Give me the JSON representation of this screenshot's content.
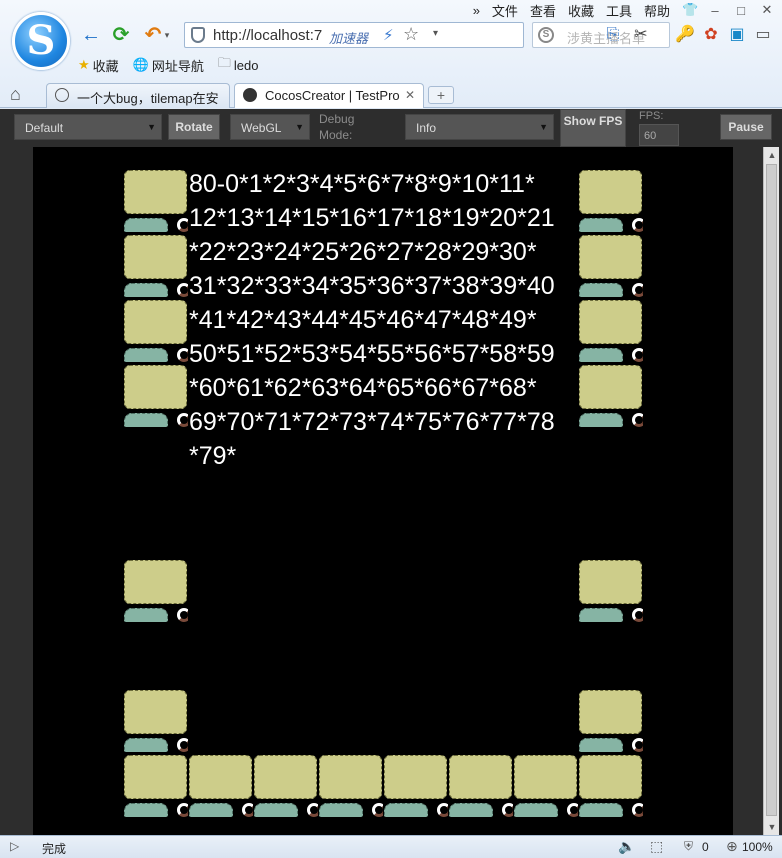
{
  "menubar": {
    "expand": "»",
    "items": [
      "文件",
      "查看",
      "收藏",
      "工具",
      "帮助"
    ],
    "skin": "👕",
    "minimize": "–",
    "maximize": "□",
    "close": "✕"
  },
  "browser": {
    "logo_letter": "S",
    "back": "←",
    "refresh": "⟳",
    "undo": "↶",
    "undo_dd": "▾",
    "url": "http://localhost:7",
    "accelerator": "加速器",
    "bolt": "⚡",
    "star": "☆",
    "url_dd": "▾",
    "search_icon": "S",
    "search_placeholder": "涉黄主播名单",
    "tools": [
      "⎘",
      "✂",
      "🔑",
      "✿",
      "▣",
      "▭"
    ]
  },
  "favorites": [
    {
      "icon": "★",
      "label": "收藏"
    },
    {
      "icon": "🌐",
      "label": "网址导航"
    },
    {
      "icon": "🗀",
      "label": "ledo"
    }
  ],
  "tabs": [
    {
      "label": "一个大bug，tilemap在安",
      "close": ""
    },
    {
      "label": "CocosCreator | TestPro",
      "close": "✕"
    }
  ],
  "home": "⌂",
  "newtab": "+",
  "cocos_toolbar": {
    "resolution": "Default",
    "rotate": "Rotate",
    "renderer": "WebGL",
    "debug_mode_label": "Debug Mode:",
    "debug_mode": "Info",
    "show_fps": "Show FPS",
    "fps_label": "FPS:",
    "fps_value": "60",
    "pause": "Pause",
    "dropdown_arrow": "▼"
  },
  "game_text": "80-0*1*2*3*4*5*6*7*8*9*10*11*\n12*13*14*15*16*17*18*19*20*21\n*22*23*24*25*26*27*28*29*30*\n31*32*33*34*35*36*37*38*39*40\n*41*42*43*44*45*46*47*48*49*\n50*51*52*53*54*55*56*57*58*59\n*60*61*62*63*64*65*66*67*68*\n69*70*71*72*73*74*75*76*77*78\n*79*",
  "scrollbar": {
    "up": "▲",
    "down": "▼"
  },
  "status": {
    "panel_icon": "▷",
    "text": "完成",
    "sound": "🔈",
    "box": "⬚",
    "count_icon": "⛨",
    "count": "0",
    "zoom_icon": "⊕",
    "zoom": "100%"
  }
}
